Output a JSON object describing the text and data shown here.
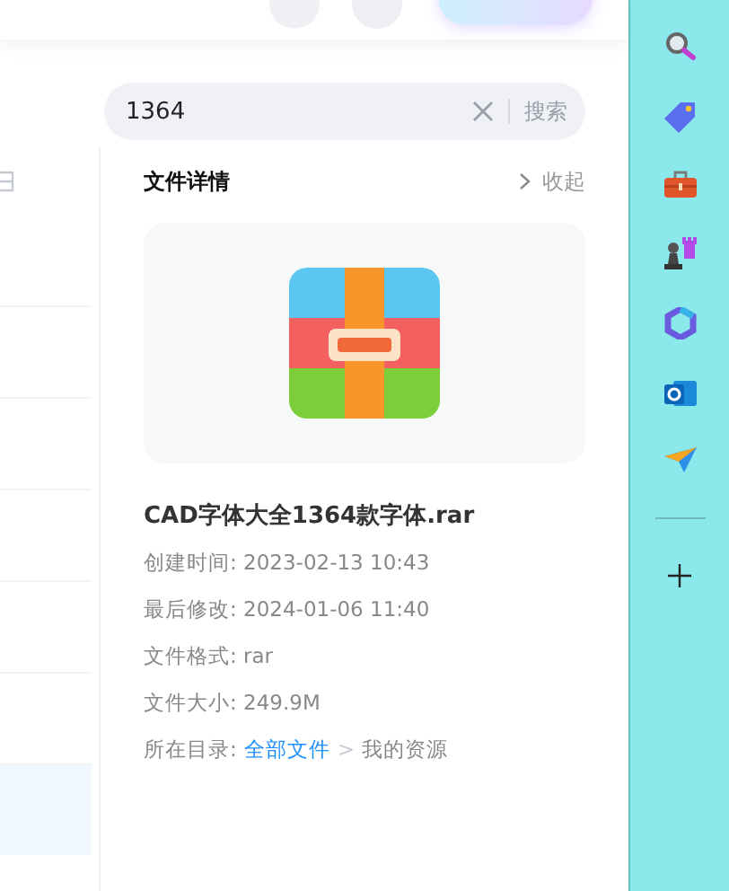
{
  "search": {
    "value": "1364",
    "button": "搜索"
  },
  "file_list": {
    "rows": [
      {
        "selected": false
      },
      {
        "selected": false
      },
      {
        "selected": false
      },
      {
        "selected": false
      },
      {
        "selected": false
      },
      {
        "selected": false
      },
      {
        "selected": true
      }
    ]
  },
  "details": {
    "title": "文件详情",
    "collapse": "收起",
    "file_name": "CAD字体大全1364款字体.rar",
    "info": [
      {
        "label": "创建时间:",
        "value": "2023-02-13 10:43"
      },
      {
        "label": "最后修改:",
        "value": "2024-01-06 11:40"
      },
      {
        "label": "文件格式:",
        "value": "rar"
      },
      {
        "label": "文件大小:",
        "value": "249.9M"
      }
    ],
    "location": {
      "label": "所在目录:",
      "link": "全部文件",
      "separator": ">",
      "current": "我的资源"
    }
  }
}
